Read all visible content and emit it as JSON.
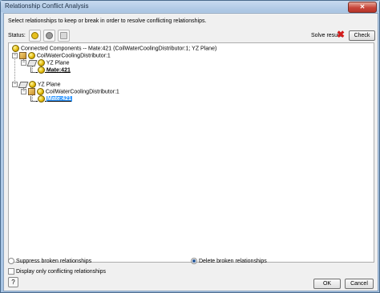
{
  "window": {
    "title": "Relationship Conflict Analysis",
    "close_label": "✕"
  },
  "instructions": "Select relationships to keep or break in order to resolve conflicting relationships.",
  "status": {
    "label": "Status:",
    "buttons": [
      {
        "icon": "mate-status-icon",
        "color": "#e6c020"
      },
      {
        "icon": "suppressed-status-icon",
        "color": "#9a9a9a"
      },
      {
        "icon": "broken-status-icon",
        "color": "#c8c8c8"
      }
    ]
  },
  "solve": {
    "label": "Solve result:",
    "result_icon": "red-x-icon",
    "result_glyph": "✖",
    "check_label": "Check"
  },
  "tree": {
    "root": "Connected Components -- Mate:421 (CoilWaterCoolingDistributor:1; YZ Plane)",
    "nodes": [
      {
        "label": "CoilWaterCoolingDistributor:1"
      },
      {
        "label": "YZ Plane"
      },
      {
        "label": "Mate:421"
      },
      {
        "label": "YZ Plane"
      },
      {
        "label": "CoilWaterCoolingDistributor:1"
      },
      {
        "label": "Mate:421"
      }
    ]
  },
  "options": {
    "suppress_label": "Suppress broken relationships",
    "delete_label": "Delete broken relationships",
    "selected": "delete",
    "display_conflicting_label": "Display only conflicting relationships",
    "display_conflicting_checked": false
  },
  "footer": {
    "help_label": "?",
    "ok_label": "OK",
    "cancel_label": "Cancel"
  },
  "colors": {
    "selection": "#3399ff",
    "error": "#d21b1b"
  }
}
